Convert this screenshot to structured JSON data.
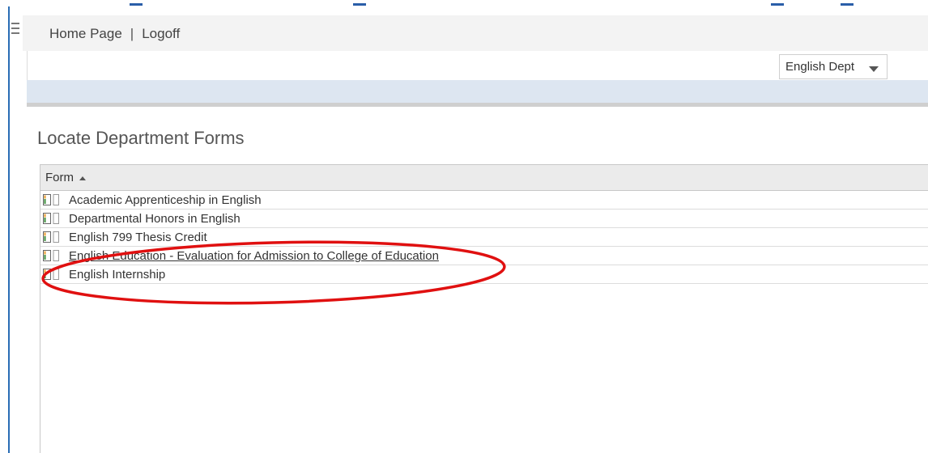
{
  "nav": {
    "home_label": "Home Page",
    "separator": "|",
    "logoff_label": "Logoff"
  },
  "department_selector": {
    "selected": "English Dept"
  },
  "page": {
    "title": "Locate Department Forms"
  },
  "grid": {
    "column_header": "Form",
    "sort_direction": "ascending",
    "rows": [
      {
        "label": "Academic Apprenticeship in English"
      },
      {
        "label": "Departmental Honors in English"
      },
      {
        "label": "English 799 Thesis Credit"
      },
      {
        "label": "English Education - Evaluation for Admission to College of Education"
      },
      {
        "label": "English Internship"
      }
    ]
  },
  "icons": {
    "form_icon": "document-form-icon",
    "menu_icon": "hamburger-menu-icon",
    "sort_icon": "sort-ascending-icon",
    "dropdown_icon": "dropdown-arrow-icon"
  },
  "annotation": {
    "highlighted_row_index": 3,
    "color": "#e01010"
  },
  "colors": {
    "accent_band": "#dde6f1",
    "frame": "#2a6db5",
    "header_bg": "#f3f3f3"
  }
}
